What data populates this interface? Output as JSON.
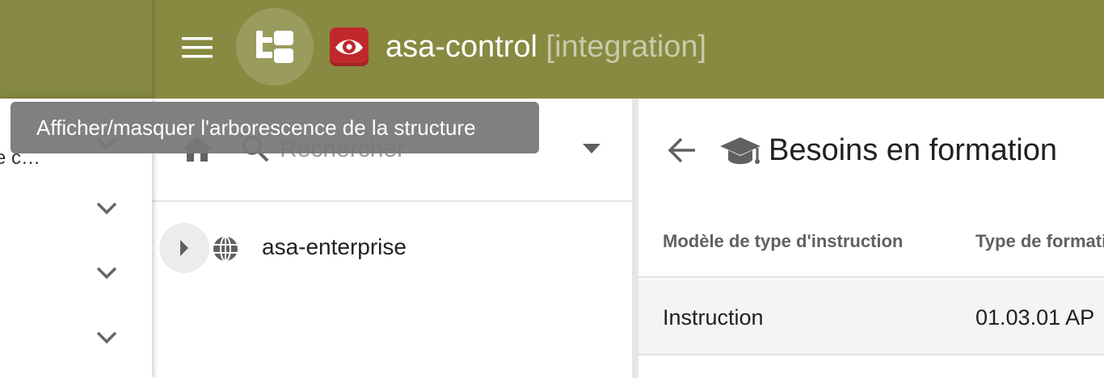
{
  "header": {
    "app_name": "asa-control",
    "environment": "[integration]",
    "menu_icon": "menu-icon",
    "tree_toggle_icon": "structure-tree-icon",
    "logo_icon": "eye-logo-icon"
  },
  "tooltip": {
    "text": "Afficher/masquer l'arborescence de la structure"
  },
  "drawer": {
    "items": [
      {
        "label": "e c…"
      },
      {
        "label": ""
      },
      {
        "label": ""
      },
      {
        "label": ""
      }
    ]
  },
  "tree": {
    "search_placeholder": "Rechercher",
    "nodes": [
      {
        "label": "asa-enterprise",
        "icon": "globe-icon"
      }
    ]
  },
  "detail": {
    "title": "Besoins en formation",
    "icon": "graduation-cap-icon",
    "columns": [
      "Modèle de type d'instruction",
      "Type de formati"
    ],
    "rows": [
      {
        "model": "Instruction",
        "type": "01.03.01 AP"
      }
    ]
  },
  "colors": {
    "appbar": "#878a40",
    "logo": "#c0282b",
    "tooltip_bg": "#787878"
  }
}
